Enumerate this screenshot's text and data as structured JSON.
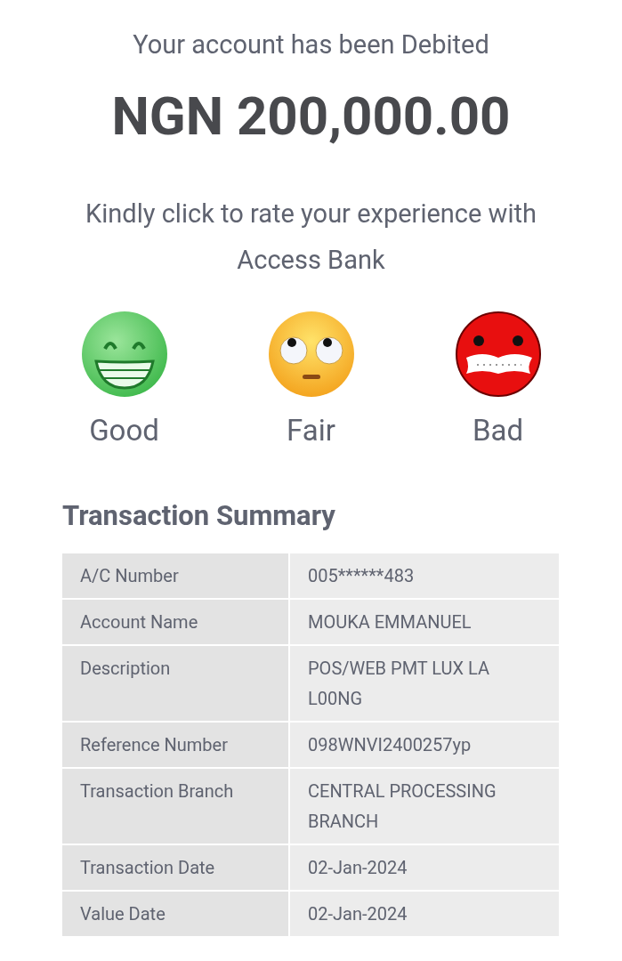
{
  "header": {
    "message": "Your account has been Debited",
    "amount": "NGN 200,000.00"
  },
  "rating": {
    "prompt": "Kindly click to rate your experience with Access Bank",
    "options": [
      {
        "kind": "good",
        "label": "Good"
      },
      {
        "kind": "fair",
        "label": "Fair"
      },
      {
        "kind": "bad",
        "label": "Bad"
      }
    ]
  },
  "summary": {
    "title": "Transaction Summary",
    "rows": [
      {
        "label": "A/C Number",
        "value": "005******483"
      },
      {
        "label": "Account Name",
        "value": "MOUKA EMMANUEL"
      },
      {
        "label": "Description",
        "value": "POS/WEB PMT LUX LA L00NG"
      },
      {
        "label": "Reference Number",
        "value": "098WNVI2400257yp"
      },
      {
        "label": "Transaction Branch",
        "value": "CENTRAL PROCESSING BRANCH"
      },
      {
        "label": "Transaction Date",
        "value": "02-Jan-2024"
      },
      {
        "label": "Value Date",
        "value": "02-Jan-2024"
      }
    ]
  }
}
